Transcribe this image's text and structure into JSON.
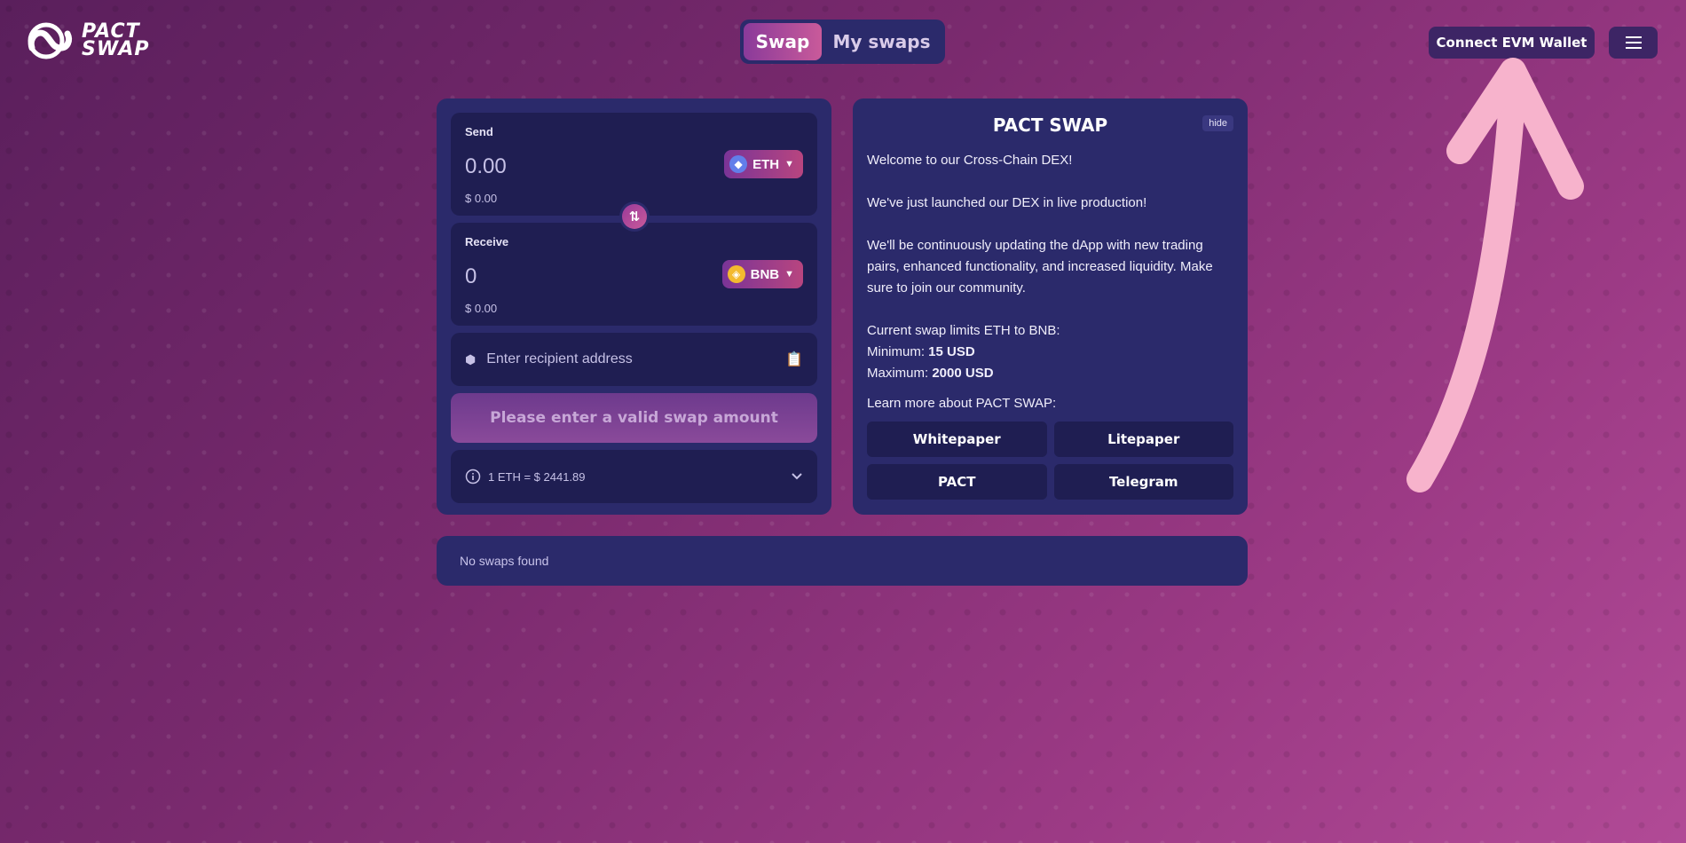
{
  "brand": {
    "line1": "PACT",
    "line2": "SWAP"
  },
  "nav": {
    "tabs": [
      {
        "label": "Swap",
        "active": true
      },
      {
        "label": "My swaps",
        "active": false
      }
    ]
  },
  "header": {
    "connect_label": "Connect EVM Wallet",
    "menu_icon": "hamburger-icon"
  },
  "swap": {
    "send": {
      "label": "Send",
      "amount": "0.00",
      "usd": "$ 0.00",
      "token": "ETH",
      "token_color": "#627eea"
    },
    "receive": {
      "label": "Receive",
      "amount": "0",
      "usd": "$ 0.00",
      "token": "BNB",
      "token_color": "#f3ba2f"
    },
    "recipient_placeholder": "Enter recipient address",
    "submit_label": "Please enter a valid swap amount",
    "rate": "1 ETH = $ 2441.89"
  },
  "info": {
    "title": "PACT SWAP",
    "hide_label": "hide",
    "p1": "Welcome to our Cross-Chain DEX!",
    "p2": "We've just launched our DEX in live production!",
    "p3": "We'll be continuously updating the dApp with new trading pairs, enhanced functionality, and increased liquidity. Make sure to join our community.",
    "limits_heading": "Current swap limits ETH to BNB:",
    "min_label": "Minimum: ",
    "min_value": "15 USD",
    "max_label": "Maximum: ",
    "max_value": "2000 USD",
    "learn_more": "Learn more about PACT SWAP:",
    "links": [
      "Whitepaper",
      "Litepaper",
      "PACT",
      "Telegram"
    ]
  },
  "history": {
    "empty_text": "No swaps found"
  },
  "colors": {
    "accent": "#c95a9a",
    "panel": "#2b2a6b",
    "card": "#1f1e52",
    "arrow": "#f7b3cc"
  }
}
